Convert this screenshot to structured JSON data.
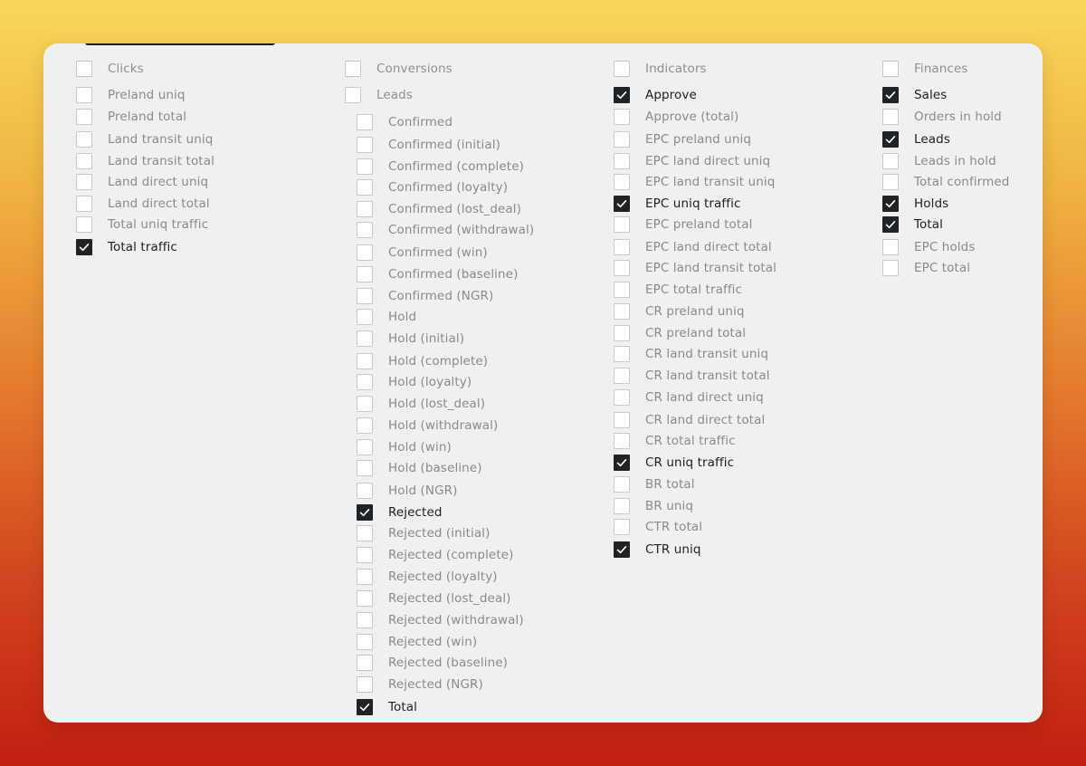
{
  "columns": [
    {
      "id": "clicks",
      "header": {
        "label": "Clicks",
        "checked": false
      },
      "items": [
        {
          "label": "Preland uniq",
          "checked": false
        },
        {
          "label": "Preland total",
          "checked": false
        },
        {
          "label": "Land transit uniq",
          "checked": false
        },
        {
          "label": "Land transit total",
          "checked": false
        },
        {
          "label": "Land direct uniq",
          "checked": false
        },
        {
          "label": "Land direct total",
          "checked": false
        },
        {
          "label": "Total uniq traffic",
          "checked": false
        },
        {
          "label": "Total traffic",
          "checked": true
        }
      ]
    },
    {
      "id": "conversions",
      "header": {
        "label": "Conversions",
        "checked": false
      },
      "group": {
        "label": "Leads",
        "checked": false
      },
      "items": [
        {
          "label": "Confirmed",
          "checked": false
        },
        {
          "label": "Confirmed (initial)",
          "checked": false
        },
        {
          "label": "Confirmed (complete)",
          "checked": false
        },
        {
          "label": "Confirmed (loyalty)",
          "checked": false
        },
        {
          "label": "Confirmed (lost_deal)",
          "checked": false
        },
        {
          "label": "Confirmed (withdrawal)",
          "checked": false
        },
        {
          "label": "Confirmed (win)",
          "checked": false
        },
        {
          "label": "Confirmed (baseline)",
          "checked": false
        },
        {
          "label": "Confirmed (NGR)",
          "checked": false
        },
        {
          "label": "Hold",
          "checked": false
        },
        {
          "label": "Hold (initial)",
          "checked": false
        },
        {
          "label": "Hold (complete)",
          "checked": false
        },
        {
          "label": "Hold (loyalty)",
          "checked": false
        },
        {
          "label": "Hold (lost_deal)",
          "checked": false
        },
        {
          "label": "Hold (withdrawal)",
          "checked": false
        },
        {
          "label": "Hold (win)",
          "checked": false
        },
        {
          "label": "Hold (baseline)",
          "checked": false
        },
        {
          "label": "Hold (NGR)",
          "checked": false
        },
        {
          "label": "Rejected",
          "checked": true
        },
        {
          "label": "Rejected (initial)",
          "checked": false
        },
        {
          "label": "Rejected (complete)",
          "checked": false
        },
        {
          "label": "Rejected (loyalty)",
          "checked": false
        },
        {
          "label": "Rejected (lost_deal)",
          "checked": false
        },
        {
          "label": "Rejected (withdrawal)",
          "checked": false
        },
        {
          "label": "Rejected (win)",
          "checked": false
        },
        {
          "label": "Rejected (baseline)",
          "checked": false
        },
        {
          "label": "Rejected (NGR)",
          "checked": false
        },
        {
          "label": "Total",
          "checked": true
        }
      ]
    },
    {
      "id": "indicators",
      "header": {
        "label": "Indicators",
        "checked": false
      },
      "items": [
        {
          "label": "Approve",
          "checked": true
        },
        {
          "label": "Approve (total)",
          "checked": false
        },
        {
          "label": "EPC preland uniq",
          "checked": false
        },
        {
          "label": "EPC land direct uniq",
          "checked": false
        },
        {
          "label": "EPC land transit uniq",
          "checked": false
        },
        {
          "label": "EPC uniq traffic",
          "checked": true
        },
        {
          "label": "EPC preland total",
          "checked": false
        },
        {
          "label": "EPC land direct total",
          "checked": false
        },
        {
          "label": "EPC land transit total",
          "checked": false
        },
        {
          "label": "EPC total traffic",
          "checked": false
        },
        {
          "label": "CR preland uniq",
          "checked": false
        },
        {
          "label": "CR preland total",
          "checked": false
        },
        {
          "label": "CR land transit uniq",
          "checked": false
        },
        {
          "label": "CR land transit total",
          "checked": false
        },
        {
          "label": "CR land direct uniq",
          "checked": false
        },
        {
          "label": "CR land direct total",
          "checked": false
        },
        {
          "label": "CR total traffic",
          "checked": false
        },
        {
          "label": "CR uniq traffic",
          "checked": true
        },
        {
          "label": "BR total",
          "checked": false
        },
        {
          "label": "BR uniq",
          "checked": false
        },
        {
          "label": "CTR total",
          "checked": false
        },
        {
          "label": "CTR uniq",
          "checked": true
        }
      ]
    },
    {
      "id": "finances",
      "header": {
        "label": "Finances",
        "checked": false
      },
      "items": [
        {
          "label": "Sales",
          "checked": true
        },
        {
          "label": "Orders in hold",
          "checked": false
        },
        {
          "label": "Leads",
          "checked": true
        },
        {
          "label": "Leads in hold",
          "checked": false
        },
        {
          "label": "Total confirmed",
          "checked": false
        },
        {
          "label": "Holds",
          "checked": true
        },
        {
          "label": "Total",
          "checked": true
        },
        {
          "label": "EPC holds",
          "checked": false
        },
        {
          "label": "EPC total",
          "checked": false
        }
      ]
    }
  ]
}
